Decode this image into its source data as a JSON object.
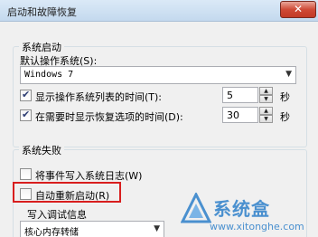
{
  "window": {
    "title": "启动和故障恢复",
    "close_label": "✕"
  },
  "startup": {
    "group_title": "系统启动",
    "default_os_label": "默认操作系统(S):",
    "default_os_value": "Windows 7",
    "show_list_label": "显示操作系统列表的时间(T):",
    "show_list_value": "5",
    "show_recovery_label": "在需要时显示恢复选项的时间(D):",
    "show_recovery_value": "30",
    "seconds_unit": "秒"
  },
  "failure": {
    "group_title": "系统失败",
    "write_event_label": "将事件写入系统日志(W)",
    "auto_restart_label": "自动重新启动(R)",
    "debug_group_title": "写入调试信息",
    "debug_value": "核心内存转储"
  },
  "watermark": {
    "brand": "系统盒",
    "url": "www.xitonghe.com"
  }
}
